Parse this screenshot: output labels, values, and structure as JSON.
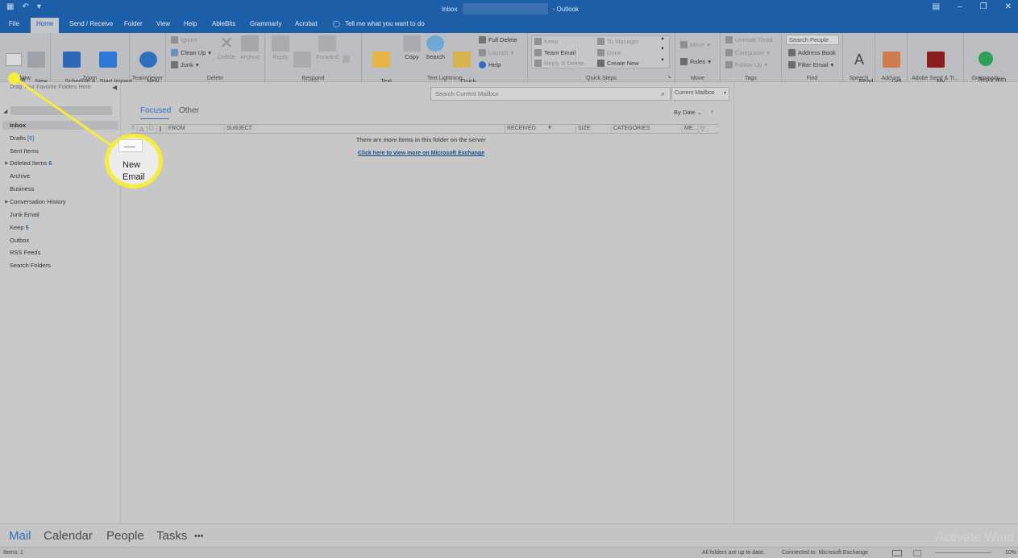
{
  "window": {
    "title": "Inbox",
    "app_name": "- Outlook"
  },
  "tabs": [
    "File",
    "Home",
    "Send / Receive",
    "Folder",
    "View",
    "Help",
    "AbleBits",
    "Grammarly",
    "Acrobat"
  ],
  "tell_me": "Tell me what you want to do",
  "ribbon": {
    "new_email": "New\nEmail",
    "new_items": "New\nItems",
    "new_group": "New",
    "schedule_meeting": "Schedule a\nMeeting",
    "start_instant_meeting": "Start Instant\nMeeting",
    "zoom_group": "Zoom",
    "new_meeting": "New\nMeeting",
    "teamviewer_group": "TeamViewer",
    "ignore": "Ignore",
    "clean_up": "Clean Up",
    "junk": "Junk",
    "delete": "Delete",
    "archive": "Archive",
    "delete_group": "Delete",
    "reply": "Reply",
    "reply_all": "Reply\nAll",
    "forward": "Forward",
    "respond_group": "Respond",
    "text_lightning": "Text\nLightning",
    "copy": "Copy",
    "search": "Search",
    "quick_move": "Quick\nMove",
    "full_delete": "Full Delete",
    "launch": "Launch",
    "help": "Help",
    "text_lightning_group": "Text Lightning",
    "qs_keep": "Keep",
    "qs_team_email": "Team Email",
    "qs_reply_delete": "Reply & Delete",
    "qs_to_manager": "To Manager",
    "qs_done": "Done",
    "qs_create_new": "Create New",
    "quick_steps_group": "Quick Steps",
    "move": "Move",
    "rules": "Rules",
    "move_group": "Move",
    "unread_read": "Unread/ Read",
    "categorize": "Categorize",
    "follow_up": "Follow Up",
    "tags_group": "Tags",
    "search_people": "Search People",
    "address_book": "Address Book",
    "filter_email": "Filter Email",
    "find_group": "Find",
    "read_aloud": "Read\nAloud",
    "speech_group": "Speech",
    "get_addins": "Get\nAdd-ins",
    "addins_group": "Add-ins",
    "my_account": "My\nAccount",
    "adobe_group": "Adobe Send & Tr...",
    "reply_grammarly": "Reply with\nGrammarly",
    "grammarly_group": "Grammarly"
  },
  "folder_pane": {
    "fav_hint": "Drag Your Favorite Folders Here",
    "folders": [
      {
        "name": "Inbox",
        "count": ""
      },
      {
        "name": "Drafts",
        "count": "[6]"
      },
      {
        "name": "Sent Items",
        "count": ""
      },
      {
        "name": "Deleted Items",
        "count": "6"
      },
      {
        "name": "Archive",
        "count": ""
      },
      {
        "name": "Business",
        "count": ""
      },
      {
        "name": "Conversation History",
        "count": ""
      },
      {
        "name": "Junk Email",
        "count": ""
      },
      {
        "name": "Keep",
        "count": "5"
      },
      {
        "name": "Outbox",
        "count": ""
      },
      {
        "name": "RSS Feeds",
        "count": ""
      },
      {
        "name": "Search Folders",
        "count": ""
      }
    ]
  },
  "list": {
    "search_placeholder": "Search Current Mailbox",
    "scope": "Current Mailbox",
    "tab_focused": "Focused",
    "tab_other": "Other",
    "sort": "By Date",
    "columns": [
      "FROM",
      "SUBJECT",
      "RECEIVED",
      "SIZE",
      "CATEGORIES",
      "ME..."
    ],
    "more_items": "There are more items in this folder on the server",
    "exchange_link": "Click here to view more on Microsoft Exchange"
  },
  "nav": [
    "Mail",
    "Calendar",
    "People",
    "Tasks",
    "•••"
  ],
  "status": {
    "items": "Items: 1",
    "sync": "All folders are up to date.",
    "connection": "Connected to: Microsoft Exchange",
    "zoom": "10%"
  },
  "watermark": "Activate Wind",
  "callout": {
    "label": "New Email"
  },
  "colors": {
    "brand_blue": "#1d5ea8",
    "callout_yellow": "#f7ec3b"
  }
}
